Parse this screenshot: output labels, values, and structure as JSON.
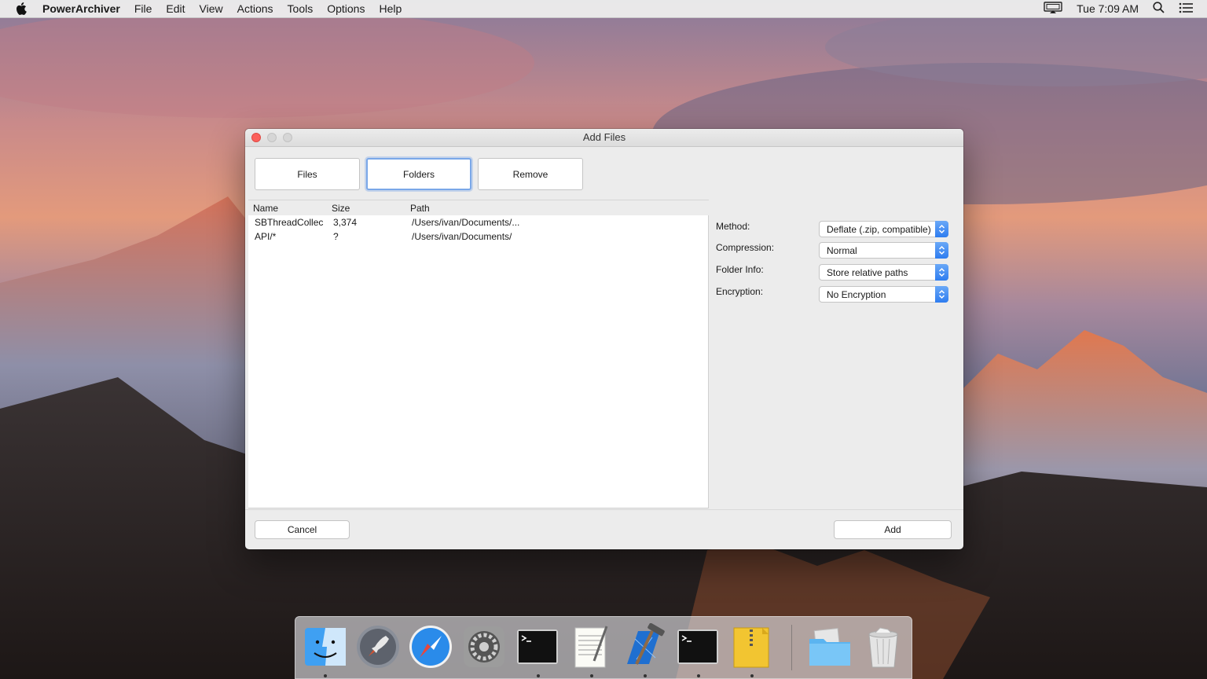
{
  "menubar": {
    "app_name": "PowerArchiver",
    "items": [
      "File",
      "Edit",
      "View",
      "Actions",
      "Tools",
      "Options",
      "Help"
    ],
    "clock": "Tue 7:09 AM"
  },
  "window": {
    "title": "Add Files",
    "toolbar": {
      "files_label": "Files",
      "folders_label": "Folders",
      "remove_label": "Remove"
    },
    "table": {
      "columns": [
        "Name",
        "Size",
        "Path"
      ],
      "rows": [
        {
          "name": "SBThreadCollec",
          "size": "3,374",
          "path": "/Users/ivan/Documents/..."
        },
        {
          "name": "API/*",
          "size": "?",
          "path": "/Users/ivan/Documents/"
        }
      ]
    },
    "options": {
      "method": {
        "label": "Method:",
        "value": "Deflate (.zip, compatible)"
      },
      "compression": {
        "label": "Compression:",
        "value": "Normal"
      },
      "folder_info": {
        "label": "Folder Info:",
        "value": "Store relative paths"
      },
      "encryption": {
        "label": "Encryption:",
        "value": "No Encryption"
      }
    },
    "cancel_label": "Cancel",
    "add_label": "Add"
  },
  "dock": {
    "items": [
      "finder-icon",
      "launchpad-icon",
      "safari-icon",
      "system-preferences-icon",
      "terminal-icon",
      "textedit-icon",
      "xcode-icon",
      "terminal-icon",
      "archive-utility-icon",
      "downloads-folder-icon",
      "trash-icon"
    ]
  },
  "colors": {
    "accent": "#2e7df0",
    "close_button": "#fc605b",
    "focus_ring": "#7aa7e8"
  }
}
